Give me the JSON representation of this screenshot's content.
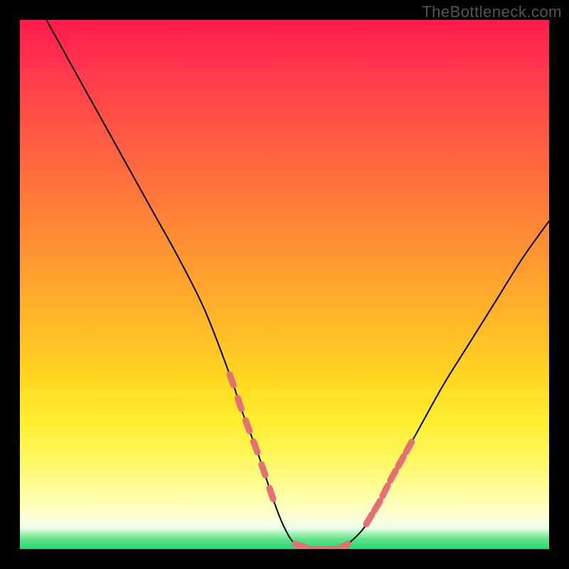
{
  "watermark": "TheBottleneck.com",
  "chart_data": {
    "type": "line",
    "title": "",
    "xlabel": "",
    "ylabel": "",
    "xlim": [
      0,
      100
    ],
    "ylim": [
      0,
      100
    ],
    "x": [
      5,
      10,
      15,
      20,
      25,
      30,
      35,
      40,
      42,
      45,
      48,
      50,
      52,
      55,
      58,
      60,
      62,
      65,
      68,
      70,
      75,
      80,
      85,
      90,
      95,
      100
    ],
    "y": [
      100,
      91,
      82,
      73,
      64,
      55,
      45,
      32,
      26,
      18,
      9,
      4,
      1,
      0,
      0,
      0,
      1,
      4,
      9,
      13,
      22,
      31,
      39,
      47,
      55,
      62
    ],
    "min_region_x": [
      50,
      62
    ],
    "marker_points_x": [
      40,
      41.5,
      43,
      44.5,
      46,
      47.5,
      53,
      55,
      57,
      59,
      61,
      66,
      67.5,
      69,
      70.5,
      72,
      73.5
    ],
    "marker_color": "#e66f73",
    "notes": "V-shaped curve on a vertical red→yellow→green gradient; salmon dotted segments flank the flat minimum. No axis ticks or labels are shown; x/y values are normalized estimates (0–100) read from curve position relative to the interior plot box."
  }
}
